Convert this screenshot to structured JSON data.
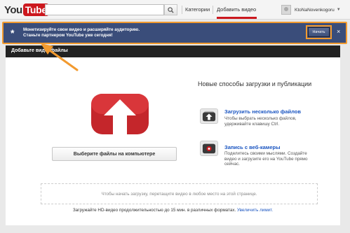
{
  "header": {
    "logo_you": "You",
    "logo_tube": "Tube",
    "search_placeholder": "",
    "nav": {
      "categories": "Категории",
      "upload": "Добавить видео"
    },
    "user": {
      "name": "KtoNaNovenkogoru"
    }
  },
  "banner": {
    "star": "*",
    "text_line1": "Монетизируйте свои видео и расширяйте аудиторию.",
    "text_line2": "Станьте партнером YouTube уже сегодня!",
    "start_button": "Начать",
    "close": "×"
  },
  "section": {
    "title": "Добавьте видеофайлы"
  },
  "main": {
    "choose_button": "Выберите файлы на компьютере",
    "right_title": "Новые способы загрузки и публикации",
    "features": [
      {
        "title": "Загрузить несколько файлов",
        "desc": "Чтобы выбрать несколько файлов, удерживайте клавишу Ctrl."
      },
      {
        "title": "Запись с веб-камеры",
        "desc": "Поделитесь своими мыслями. Создайте видео и загрузите его на YouTube прямо сейчас."
      }
    ],
    "dropzone": "Чтобы начать загрузку, перетащите видео в любое место на этой странице.",
    "hd_note": "Загружайте HD-видео продолжительностью до 15 мин. в различных форматах.",
    "hd_link": "Увеличить лимит."
  },
  "colors": {
    "accent_red": "#cc181e",
    "banner_bg": "#3a4d7a",
    "highlight_orange": "#f29a2f",
    "link_blue": "#1a55c1"
  },
  "icons": [
    "search-icon",
    "upload-arrow-icon",
    "multi-file-icon",
    "webcam-icon",
    "close-icon",
    "star-icon"
  ]
}
